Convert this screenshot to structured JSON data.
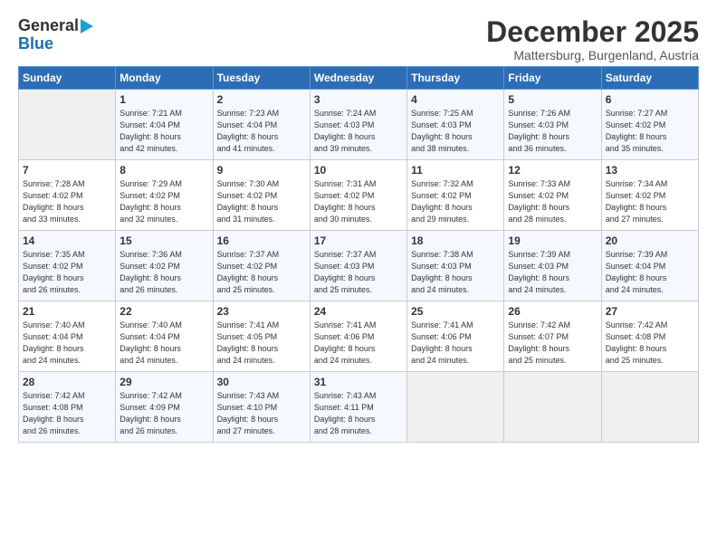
{
  "header": {
    "logo_general": "General",
    "logo_blue": "Blue",
    "month": "December 2025",
    "location": "Mattersburg, Burgenland, Austria"
  },
  "days_of_week": [
    "Sunday",
    "Monday",
    "Tuesday",
    "Wednesday",
    "Thursday",
    "Friday",
    "Saturday"
  ],
  "weeks": [
    [
      {
        "day": "",
        "info": ""
      },
      {
        "day": "1",
        "info": "Sunrise: 7:21 AM\nSunset: 4:04 PM\nDaylight: 8 hours\nand 42 minutes."
      },
      {
        "day": "2",
        "info": "Sunrise: 7:23 AM\nSunset: 4:04 PM\nDaylight: 8 hours\nand 41 minutes."
      },
      {
        "day": "3",
        "info": "Sunrise: 7:24 AM\nSunset: 4:03 PM\nDaylight: 8 hours\nand 39 minutes."
      },
      {
        "day": "4",
        "info": "Sunrise: 7:25 AM\nSunset: 4:03 PM\nDaylight: 8 hours\nand 38 minutes."
      },
      {
        "day": "5",
        "info": "Sunrise: 7:26 AM\nSunset: 4:03 PM\nDaylight: 8 hours\nand 36 minutes."
      },
      {
        "day": "6",
        "info": "Sunrise: 7:27 AM\nSunset: 4:02 PM\nDaylight: 8 hours\nand 35 minutes."
      }
    ],
    [
      {
        "day": "7",
        "info": "Sunrise: 7:28 AM\nSunset: 4:02 PM\nDaylight: 8 hours\nand 33 minutes."
      },
      {
        "day": "8",
        "info": "Sunrise: 7:29 AM\nSunset: 4:02 PM\nDaylight: 8 hours\nand 32 minutes."
      },
      {
        "day": "9",
        "info": "Sunrise: 7:30 AM\nSunset: 4:02 PM\nDaylight: 8 hours\nand 31 minutes."
      },
      {
        "day": "10",
        "info": "Sunrise: 7:31 AM\nSunset: 4:02 PM\nDaylight: 8 hours\nand 30 minutes."
      },
      {
        "day": "11",
        "info": "Sunrise: 7:32 AM\nSunset: 4:02 PM\nDaylight: 8 hours\nand 29 minutes."
      },
      {
        "day": "12",
        "info": "Sunrise: 7:33 AM\nSunset: 4:02 PM\nDaylight: 8 hours\nand 28 minutes."
      },
      {
        "day": "13",
        "info": "Sunrise: 7:34 AM\nSunset: 4:02 PM\nDaylight: 8 hours\nand 27 minutes."
      }
    ],
    [
      {
        "day": "14",
        "info": "Sunrise: 7:35 AM\nSunset: 4:02 PM\nDaylight: 8 hours\nand 26 minutes."
      },
      {
        "day": "15",
        "info": "Sunrise: 7:36 AM\nSunset: 4:02 PM\nDaylight: 8 hours\nand 26 minutes."
      },
      {
        "day": "16",
        "info": "Sunrise: 7:37 AM\nSunset: 4:02 PM\nDaylight: 8 hours\nand 25 minutes."
      },
      {
        "day": "17",
        "info": "Sunrise: 7:37 AM\nSunset: 4:03 PM\nDaylight: 8 hours\nand 25 minutes."
      },
      {
        "day": "18",
        "info": "Sunrise: 7:38 AM\nSunset: 4:03 PM\nDaylight: 8 hours\nand 24 minutes."
      },
      {
        "day": "19",
        "info": "Sunrise: 7:39 AM\nSunset: 4:03 PM\nDaylight: 8 hours\nand 24 minutes."
      },
      {
        "day": "20",
        "info": "Sunrise: 7:39 AM\nSunset: 4:04 PM\nDaylight: 8 hours\nand 24 minutes."
      }
    ],
    [
      {
        "day": "21",
        "info": "Sunrise: 7:40 AM\nSunset: 4:04 PM\nDaylight: 8 hours\nand 24 minutes."
      },
      {
        "day": "22",
        "info": "Sunrise: 7:40 AM\nSunset: 4:04 PM\nDaylight: 8 hours\nand 24 minutes."
      },
      {
        "day": "23",
        "info": "Sunrise: 7:41 AM\nSunset: 4:05 PM\nDaylight: 8 hours\nand 24 minutes."
      },
      {
        "day": "24",
        "info": "Sunrise: 7:41 AM\nSunset: 4:06 PM\nDaylight: 8 hours\nand 24 minutes."
      },
      {
        "day": "25",
        "info": "Sunrise: 7:41 AM\nSunset: 4:06 PM\nDaylight: 8 hours\nand 24 minutes."
      },
      {
        "day": "26",
        "info": "Sunrise: 7:42 AM\nSunset: 4:07 PM\nDaylight: 8 hours\nand 25 minutes."
      },
      {
        "day": "27",
        "info": "Sunrise: 7:42 AM\nSunset: 4:08 PM\nDaylight: 8 hours\nand 25 minutes."
      }
    ],
    [
      {
        "day": "28",
        "info": "Sunrise: 7:42 AM\nSunset: 4:08 PM\nDaylight: 8 hours\nand 26 minutes."
      },
      {
        "day": "29",
        "info": "Sunrise: 7:42 AM\nSunset: 4:09 PM\nDaylight: 8 hours\nand 26 minutes."
      },
      {
        "day": "30",
        "info": "Sunrise: 7:43 AM\nSunset: 4:10 PM\nDaylight: 8 hours\nand 27 minutes."
      },
      {
        "day": "31",
        "info": "Sunrise: 7:43 AM\nSunset: 4:11 PM\nDaylight: 8 hours\nand 28 minutes."
      },
      {
        "day": "",
        "info": ""
      },
      {
        "day": "",
        "info": ""
      },
      {
        "day": "",
        "info": ""
      }
    ]
  ]
}
